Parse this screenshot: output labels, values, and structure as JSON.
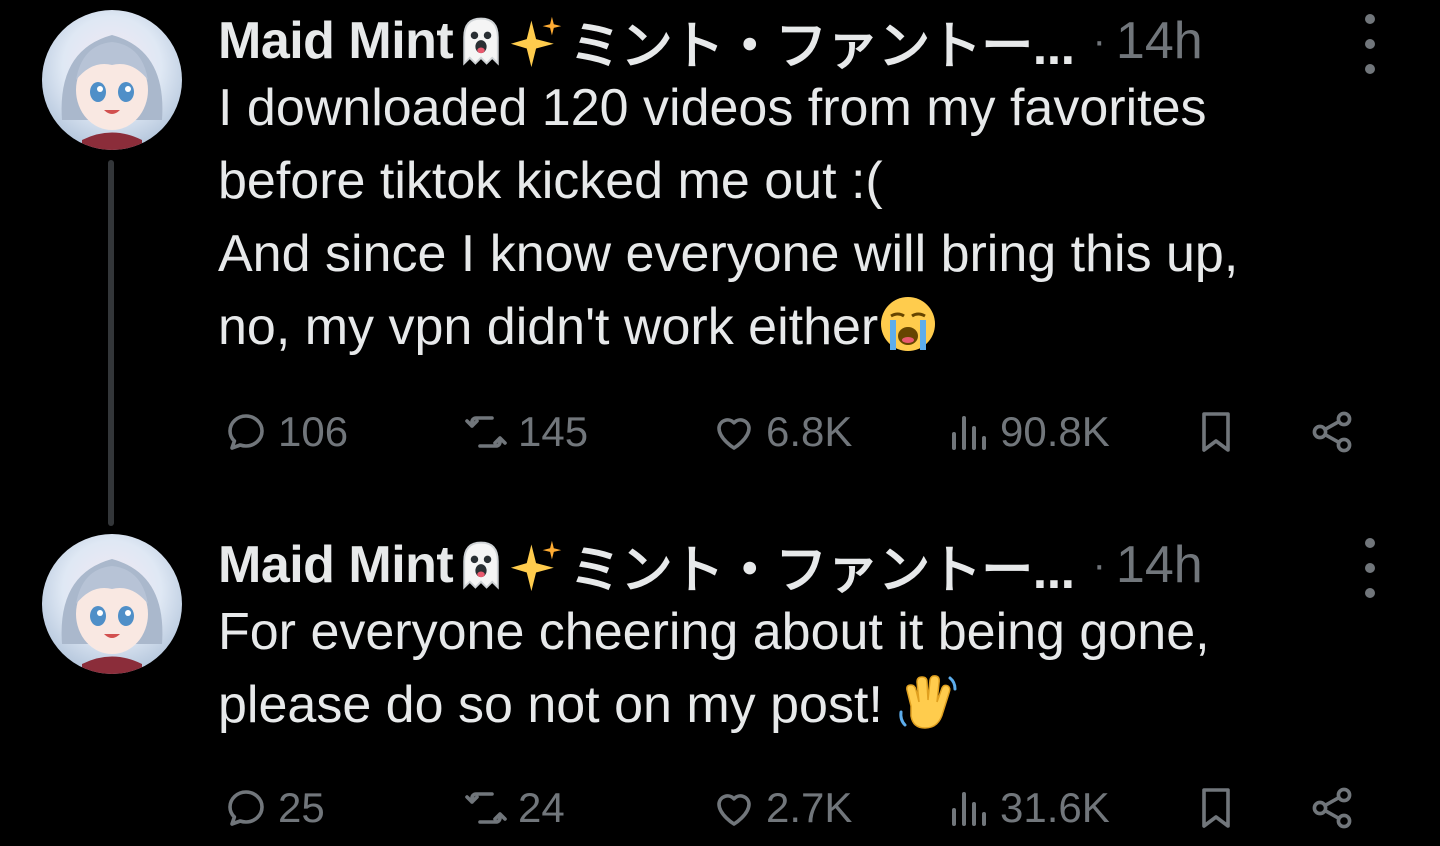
{
  "tweets": [
    {
      "author_name": "Maid Mint",
      "author_suffix": "ミント・ファントー...",
      "dot": "·",
      "time": "14h",
      "lines": [
        "I downloaded 120 videos from my favorites",
        "before tiktok kicked me out :(",
        "And since I know everyone will bring this up,",
        "no, my vpn didn't work either"
      ],
      "replies": "106",
      "reposts": "145",
      "likes": "6.8K",
      "views": "90.8K"
    },
    {
      "author_name": "Maid Mint",
      "author_suffix": "ミント・ファントー...",
      "dot": "·",
      "time": "14h",
      "lines": [
        "For everyone cheering about it being gone,",
        "please do so not on my post!"
      ],
      "replies": "25",
      "reposts": "24",
      "likes": "2.7K",
      "views": "31.6K"
    }
  ],
  "icons": {
    "name_emojis": [
      "ghost-emoji",
      "sparkles-emoji"
    ],
    "tweet1_trailing_emoji": "loudly-crying-emoji",
    "tweet2_trailing_emoji": "waving-hand-emoji",
    "actions": [
      "reply-icon",
      "repost-icon",
      "like-icon",
      "views-icon",
      "bookmark-icon",
      "share-icon"
    ]
  },
  "colors": {
    "background": "#000000",
    "text": "#e7e9ea",
    "muted": "#71767b",
    "thread_line": "#333639"
  }
}
